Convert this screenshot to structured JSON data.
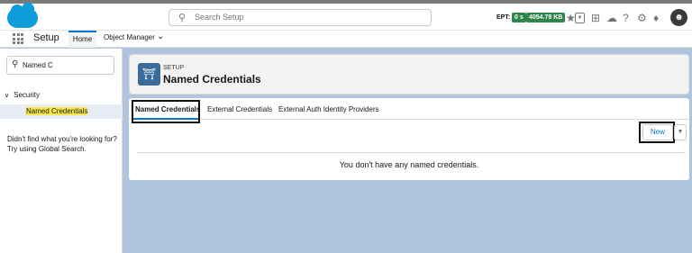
{
  "header": {
    "search_placeholder": "Search Setup",
    "ept_label": "EPT:",
    "ept_time": "0 s",
    "ept_size": "4054.79 KB"
  },
  "nav": {
    "app_name": "Setup",
    "tabs": [
      {
        "label": "Home"
      },
      {
        "label": "Object Manager"
      }
    ]
  },
  "sidebar": {
    "quick_find_value": "Named C",
    "section": "Security",
    "item": "Named Credentials",
    "help_text": "Didn't find what you're looking for? Try using Global Search."
  },
  "page_header": {
    "crumb": "SETUP",
    "title": "Named Credentials"
  },
  "tabs": [
    {
      "label": "Named Credentials",
      "active": true
    },
    {
      "label": "External Credentials",
      "active": false
    },
    {
      "label": "External Auth Identity Providers",
      "active": false
    }
  ],
  "actions": {
    "new_label": "New"
  },
  "empty_message": "You don't have any named credentials."
}
